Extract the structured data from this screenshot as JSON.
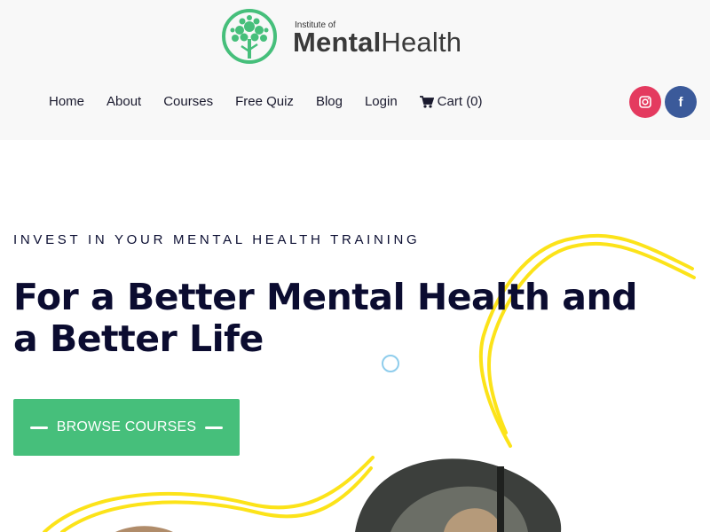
{
  "logo": {
    "line1": "Institute of",
    "bold": "Mental",
    "light": "Health",
    "mark_color": "#46bf7b"
  },
  "nav": {
    "items": [
      {
        "label": "Home"
      },
      {
        "label": "About"
      },
      {
        "label": "Courses"
      },
      {
        "label": "Free Quiz"
      },
      {
        "label": "Blog"
      },
      {
        "label": "Login"
      }
    ],
    "cart": {
      "label": "Cart",
      "count": "(0)",
      "icon": "cart-icon"
    }
  },
  "social": [
    {
      "name": "instagram",
      "icon": "instagram-icon",
      "color": "#e43a5f"
    },
    {
      "name": "facebook",
      "icon": "facebook-icon",
      "glyph": "f",
      "color": "#3b5a9a"
    }
  ],
  "hero": {
    "eyebrow": "INVEST IN YOUR MENTAL HEALTH TRAINING",
    "headline": "For a Better Mental Health and a Better Life",
    "cta_label": "BROWSE COURSES",
    "cta_color": "#46bf7b",
    "accent_color": "#fce319"
  }
}
